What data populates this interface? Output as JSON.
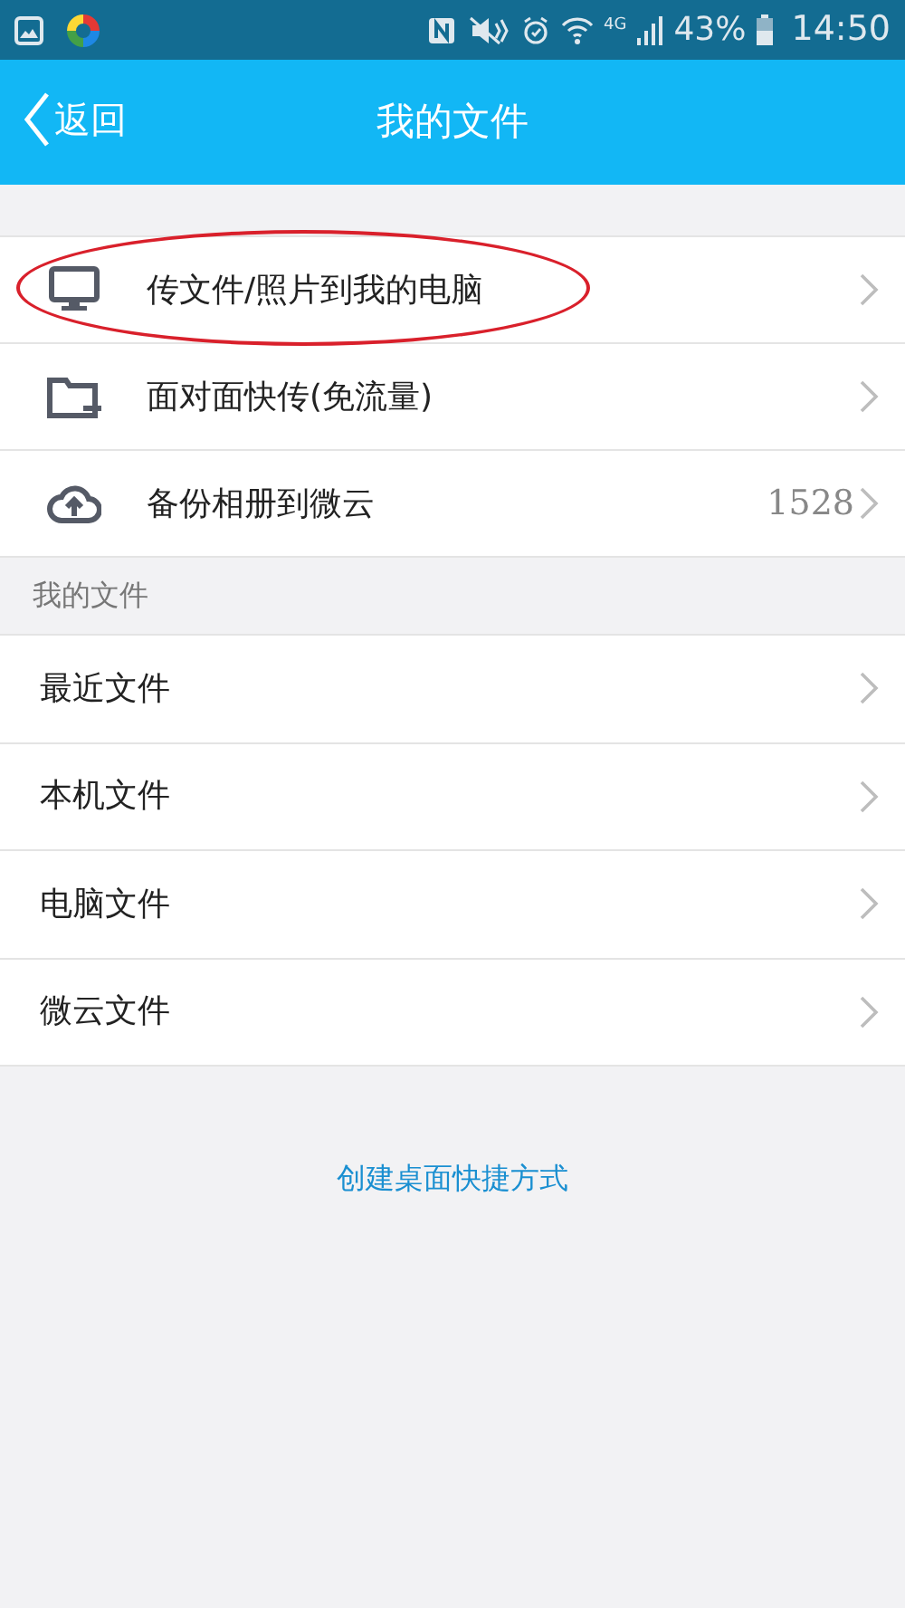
{
  "status_bar": {
    "battery": "43%",
    "time": "14:50",
    "network": "4G"
  },
  "header": {
    "back": "返回",
    "title": "我的文件"
  },
  "actions": [
    {
      "kind": "monitor",
      "label": "传文件/照片到我的电脑",
      "circled": true
    },
    {
      "kind": "folder",
      "label": "面对面快传(免流量)",
      "circled": false
    },
    {
      "kind": "cloud",
      "label": "备份相册到微云",
      "count": "1528",
      "circled": false
    }
  ],
  "section": {
    "title": "我的文件",
    "items": [
      {
        "label": "最近文件"
      },
      {
        "label": "本机文件"
      },
      {
        "label": "电脑文件"
      },
      {
        "label": "微云文件"
      }
    ]
  },
  "shortcut_link": "创建桌面快捷方式"
}
